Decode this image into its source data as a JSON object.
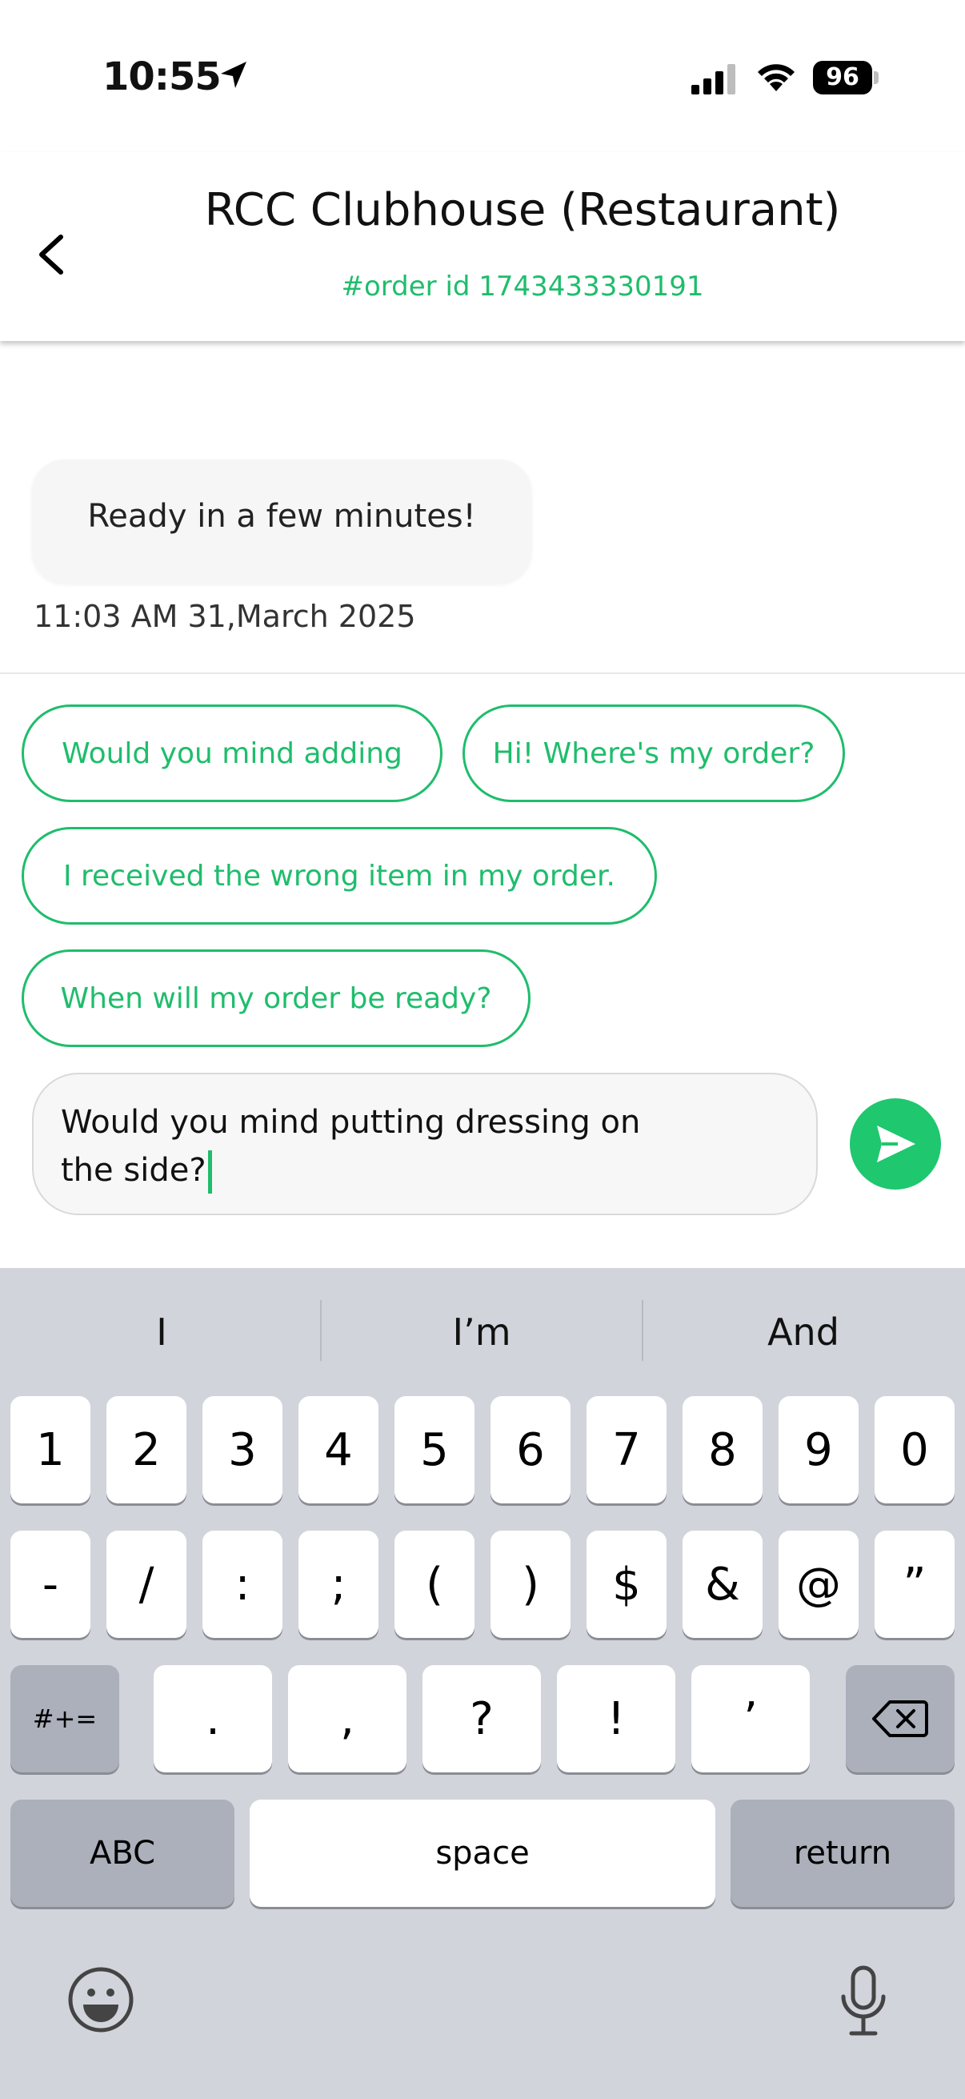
{
  "status_bar": {
    "time": "10:55",
    "battery": "96"
  },
  "header": {
    "title": "RCC Clubhouse (Restaurant)",
    "subtitle": "#order id 1743433330191"
  },
  "chat": {
    "messages": [
      {
        "text": "Ready in a few minutes!",
        "time": "11:03 AM 31,March 2025"
      }
    ]
  },
  "quick_replies": [
    "Would you mind adding",
    "Hi! Where's my order?",
    "I received the wrong item in my order.",
    "When will my order be ready?"
  ],
  "composer": {
    "line1": "Would you mind putting dressing on",
    "line2": "the side?"
  },
  "keyboard": {
    "suggestions": [
      "I",
      "I’m",
      "And"
    ],
    "row1": [
      "1",
      "2",
      "3",
      "4",
      "5",
      "6",
      "7",
      "8",
      "9",
      "0"
    ],
    "row2": [
      "-",
      "/",
      ":",
      ";",
      "(",
      ")",
      "$",
      "&",
      "@",
      "”"
    ],
    "row3": [
      ".",
      ",",
      "?",
      "!",
      "’"
    ],
    "symbols_label": "#+=",
    "abc_label": "ABC",
    "space_label": "space",
    "return_label": "return"
  },
  "colors": {
    "accent": "#1fbd6c",
    "keyboard_bg": "#d1d4da"
  }
}
